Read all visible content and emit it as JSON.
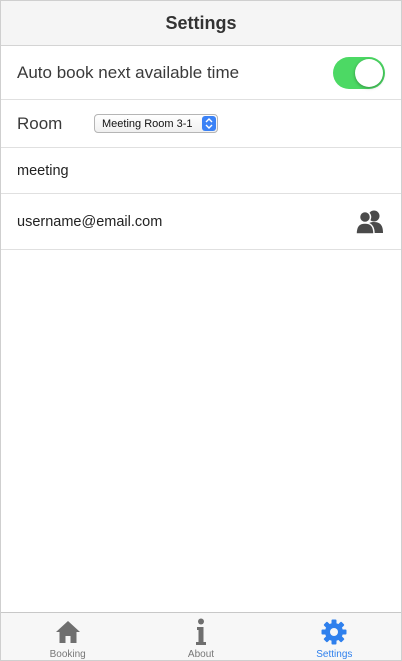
{
  "header": {
    "title": "Settings"
  },
  "settings": {
    "auto_book": {
      "label": "Auto book next available time",
      "enabled": true
    },
    "room": {
      "label": "Room",
      "selected": "Meeting Room 3-1"
    },
    "meeting_name": "meeting",
    "username": "username@email.com",
    "contacts_icon": "contacts-icon"
  },
  "tabbar": {
    "tabs": [
      {
        "label": "Booking",
        "icon": "home-icon",
        "active": false
      },
      {
        "label": "About",
        "icon": "info-icon",
        "active": false
      },
      {
        "label": "Settings",
        "icon": "gear-icon",
        "active": true
      }
    ]
  },
  "colors": {
    "toggle_on": "#4cd964",
    "active_tab": "#2f80ed",
    "inactive_tab": "#6f6f6f",
    "select_accent": "#3b82f6"
  }
}
